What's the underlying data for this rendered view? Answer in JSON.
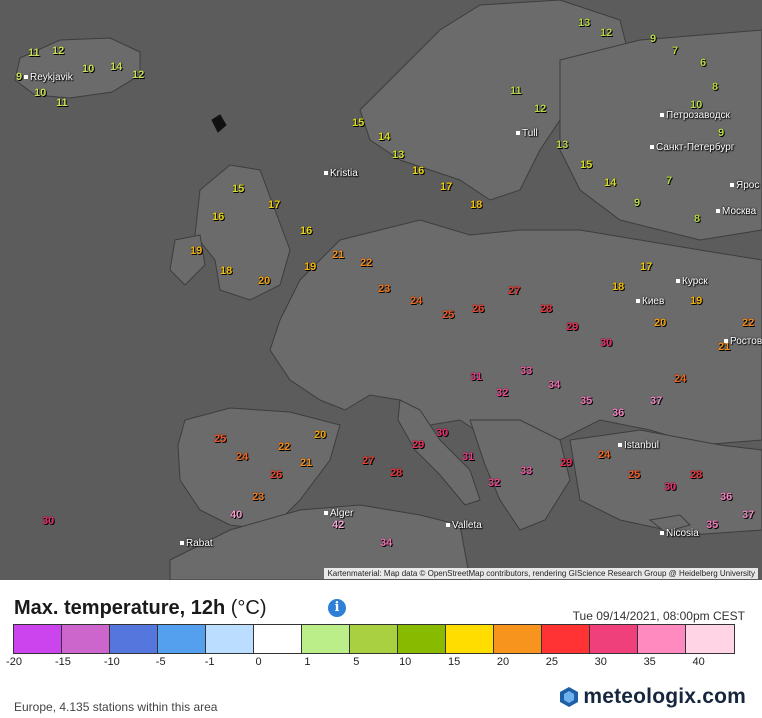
{
  "map": {
    "attribution": "Kartenmaterial: Map data © OpenStreetMap contributors, rendering GIScience Research Group @ Heidelberg University",
    "cities": [
      "Reykjavik",
      "Kristia",
      "Tull",
      "Alger",
      "Rabat",
      "Istanbul",
      "Valleta",
      "Nicosia",
      "Киев",
      "Курск",
      "Петрозаводск",
      "Санкт-Петербург",
      "Москва",
      "Ярос",
      "Ростов"
    ],
    "stations": [
      {
        "t": "11",
        "c": "#c8e05a"
      },
      {
        "t": "12",
        "c": "#c8e05a"
      },
      {
        "t": "10",
        "c": "#c8e05a"
      },
      {
        "t": "14",
        "c": "#c8e05a"
      },
      {
        "t": "12",
        "c": "#c8e05a"
      },
      {
        "t": "9",
        "c": "#c8e05a"
      },
      {
        "t": "10",
        "c": "#c8e05a"
      },
      {
        "t": "11",
        "c": "#c8e05a"
      },
      {
        "t": "13",
        "c": "#b7d84a"
      },
      {
        "t": "12",
        "c": "#b7d84a"
      },
      {
        "t": "9",
        "c": "#b7d84a"
      },
      {
        "t": "7",
        "c": "#b7d84a"
      },
      {
        "t": "6",
        "c": "#b7d84a"
      },
      {
        "t": "8",
        "c": "#b7d84a"
      },
      {
        "t": "10",
        "c": "#b7d84a"
      },
      {
        "t": "9",
        "c": "#b7d84a"
      },
      {
        "t": "15",
        "c": "#d8df2a"
      },
      {
        "t": "14",
        "c": "#d8df2a"
      },
      {
        "t": "13",
        "c": "#d8df2a"
      },
      {
        "t": "16",
        "c": "#e8d51a"
      },
      {
        "t": "17",
        "c": "#f0cc10"
      },
      {
        "t": "18",
        "c": "#f0c010"
      },
      {
        "t": "15",
        "c": "#d8df2a"
      },
      {
        "t": "16",
        "c": "#e8d51a"
      },
      {
        "t": "17",
        "c": "#f0cc10"
      },
      {
        "t": "16",
        "c": "#e8d51a"
      },
      {
        "t": "19",
        "c": "#f0b010"
      },
      {
        "t": "18",
        "c": "#f0c010"
      },
      {
        "t": "20",
        "c": "#f2a412"
      },
      {
        "t": "19",
        "c": "#f0b010"
      },
      {
        "t": "21",
        "c": "#f59116"
      },
      {
        "t": "22",
        "c": "#f4881a"
      },
      {
        "t": "23",
        "c": "#f27a1e"
      },
      {
        "t": "24",
        "c": "#f06a24"
      },
      {
        "t": "25",
        "c": "#ef5a2a"
      },
      {
        "t": "26",
        "c": "#ec4a30"
      },
      {
        "t": "27",
        "c": "#ea4034"
      },
      {
        "t": "28",
        "c": "#e83640"
      },
      {
        "t": "29",
        "c": "#e8305a"
      },
      {
        "t": "30",
        "c": "#e8306e"
      },
      {
        "t": "31",
        "c": "#ea3c84"
      },
      {
        "t": "32",
        "c": "#ee4a94"
      },
      {
        "t": "33",
        "c": "#f060a6"
      },
      {
        "t": "34",
        "c": "#f070b2"
      },
      {
        "t": "35",
        "c": "#f07ab8"
      },
      {
        "t": "36",
        "c": "#f287c0"
      },
      {
        "t": "37",
        "c": "#f08ec4"
      },
      {
        "t": "40",
        "c": "#f29ccc"
      },
      {
        "t": "42",
        "c": "#f5aad4"
      },
      {
        "t": "25",
        "c": "#ef5a2a"
      },
      {
        "t": "24",
        "c": "#f06a24"
      },
      {
        "t": "26",
        "c": "#ec4a30"
      },
      {
        "t": "23",
        "c": "#f27a1e"
      },
      {
        "t": "22",
        "c": "#f4881a"
      },
      {
        "t": "21",
        "c": "#f59116"
      },
      {
        "t": "20",
        "c": "#f2a412"
      },
      {
        "t": "27",
        "c": "#ea4034"
      },
      {
        "t": "28",
        "c": "#e83640"
      },
      {
        "t": "29",
        "c": "#e8305a"
      },
      {
        "t": "30",
        "c": "#e8306e"
      },
      {
        "t": "31",
        "c": "#ea3c84"
      },
      {
        "t": "32",
        "c": "#ee4a94"
      },
      {
        "t": "33",
        "c": "#f060a6"
      },
      {
        "t": "29",
        "c": "#e8305a"
      },
      {
        "t": "24",
        "c": "#f06a24"
      },
      {
        "t": "25",
        "c": "#ef5a2a"
      },
      {
        "t": "30",
        "c": "#e8306e"
      },
      {
        "t": "28",
        "c": "#e83640"
      },
      {
        "t": "36",
        "c": "#f287c0"
      },
      {
        "t": "37",
        "c": "#f08ec4"
      },
      {
        "t": "35",
        "c": "#f07ab8"
      },
      {
        "t": "34",
        "c": "#f070b2"
      },
      {
        "t": "11",
        "c": "#b7d84a"
      },
      {
        "t": "12",
        "c": "#b7d84a"
      },
      {
        "t": "13",
        "c": "#b7d84a"
      },
      {
        "t": "15",
        "c": "#d8df2a"
      },
      {
        "t": "14",
        "c": "#d8df2a"
      },
      {
        "t": "9",
        "c": "#b7d84a"
      },
      {
        "t": "7",
        "c": "#b7d84a"
      },
      {
        "t": "8",
        "c": "#b7d84a"
      },
      {
        "t": "17",
        "c": "#f0cc10"
      },
      {
        "t": "18",
        "c": "#f0c010"
      },
      {
        "t": "20",
        "c": "#f2a412"
      },
      {
        "t": "19",
        "c": "#f0b010"
      },
      {
        "t": "21",
        "c": "#f59116"
      },
      {
        "t": "22",
        "c": "#f4881a"
      },
      {
        "t": "24",
        "c": "#f06a24"
      },
      {
        "t": "30",
        "c": "#e8306e"
      }
    ]
  },
  "legend": {
    "title": "Max. temperature, 12h",
    "unit": "(°C)",
    "info_icon": "info-icon",
    "timestamp": "Tue 09/14/2021, 08:00pm CEST",
    "swatches": [
      "#cc44ee",
      "#cc66cc",
      "#5577dd",
      "#55a0ee",
      "#bbddff",
      "#ffffff",
      "#bbee88",
      "#a8d040",
      "#88bb00",
      "#ffdd00",
      "#f7941d",
      "#ff3333",
      "#f0407c",
      "#ff8ac0",
      "#ffd4e4"
    ],
    "ticks": [
      "-20",
      "-15",
      "-10",
      "-5",
      "-1",
      "0",
      "1",
      "5",
      "10",
      "15",
      "20",
      "25",
      "30",
      "35",
      "40"
    ]
  },
  "footer": {
    "note": "Europe, 4.135 stations within this area",
    "brand": "meteologix.com",
    "brand_icon": "meteologix-logo-icon"
  }
}
